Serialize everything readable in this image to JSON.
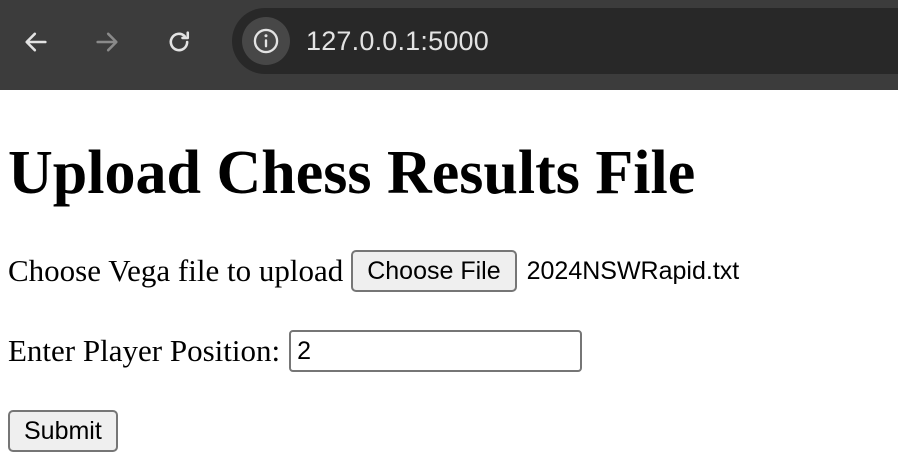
{
  "browser": {
    "url": "127.0.0.1:5000",
    "icons": {
      "back": "back-arrow-icon",
      "forward": "forward-arrow-icon",
      "reload": "reload-icon",
      "site_info": "info-icon"
    },
    "colors": {
      "toolbar": "#3c3c3c",
      "omnibox": "#282828",
      "url_text": "#e3e3e3",
      "forward_disabled": "#8a8a8a"
    }
  },
  "page": {
    "title": "Upload Chess Results File",
    "file_label": "Choose Vega file to upload",
    "file_button": "Choose File",
    "file_name": "2024NSWRapid.txt",
    "position_label": "Enter Player Position:",
    "position_value": "2",
    "submit_label": "Submit"
  }
}
